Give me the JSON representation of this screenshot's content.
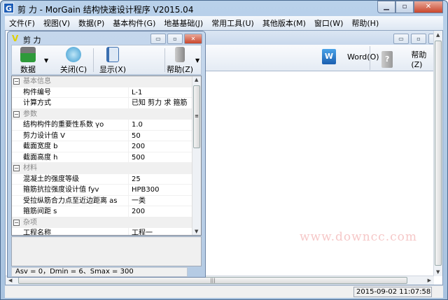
{
  "app": {
    "icon_text": "G",
    "title": "剪 力 - MorGain 结构快速设计程序 V2015.04"
  },
  "menu": [
    "文件(F)",
    "视图(V)",
    "数据(P)",
    "基本构件(G)",
    "地基基础(J)",
    "常用工具(U)",
    "其他版本(M)",
    "窗口(W)",
    "帮助(H)"
  ],
  "back_window": {
    "toolbar": {
      "word": "Word(O)",
      "help": "帮助(Z)"
    }
  },
  "child": {
    "icon_text": "V",
    "title": "剪 力",
    "toolbar": {
      "data": "数据",
      "close": "关闭(C)",
      "show": "显示(X)",
      "help": "帮助(Z)"
    },
    "grid": [
      {
        "type": "cat",
        "label": "基本信息"
      },
      {
        "label": "构件编号",
        "value": "L-1"
      },
      {
        "label": "计算方式",
        "value": "已知 剪力 求 箍筋"
      },
      {
        "type": "cat",
        "label": "参数"
      },
      {
        "label": "结构构件的重要性系数 γo",
        "value": "1.0"
      },
      {
        "label": "剪力设计值 V",
        "value": "50"
      },
      {
        "label": "截面宽度 b",
        "value": "200"
      },
      {
        "label": "截面高度 h",
        "value": "500"
      },
      {
        "type": "cat",
        "label": "材料"
      },
      {
        "label": "混凝土的强度等级",
        "value": "25"
      },
      {
        "label": "箍筋抗拉强度设计值 fyv",
        "value": "HPB300"
      },
      {
        "label": "受拉纵筋合力点至近边距离 as",
        "value": "一类"
      },
      {
        "label": "箍筋间距 s",
        "value": "200"
      },
      {
        "type": "cat",
        "label": "杂项"
      },
      {
        "label": "工程名称",
        "value": "工程一"
      }
    ],
    "status": "Asv = 0，Dmin = 6、Smax = 300"
  },
  "watermark": "www.downcc.com",
  "statusbar": {
    "datetime": "2015-09-02 11:07:58"
  }
}
